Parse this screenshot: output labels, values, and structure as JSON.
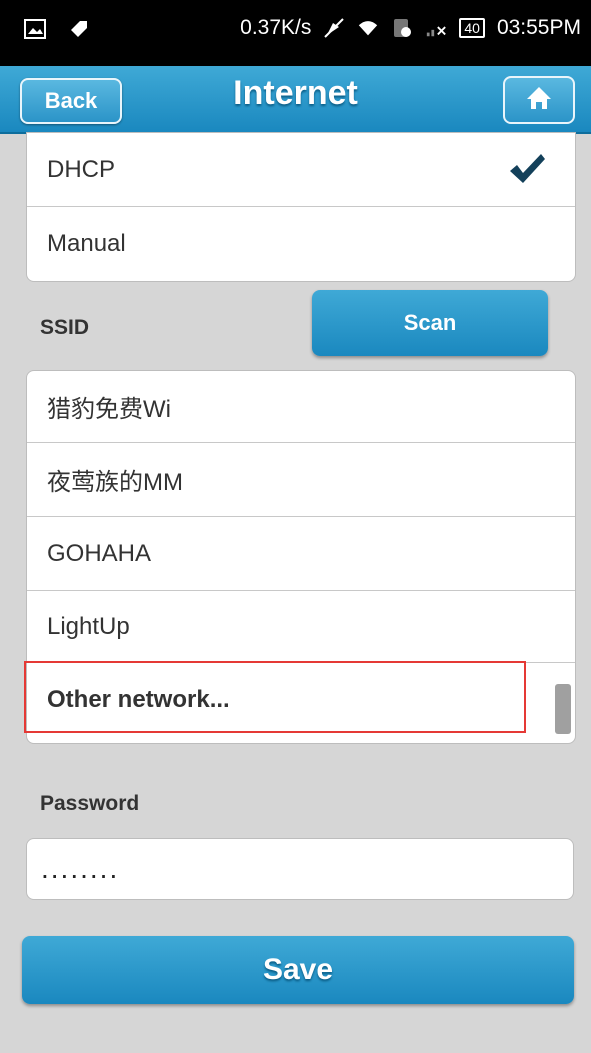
{
  "status_bar": {
    "speed": "0.37K/s",
    "battery": "40",
    "time": "03:55PM"
  },
  "header": {
    "title": "Internet",
    "back_label": "Back"
  },
  "ip_mode": {
    "options": [
      {
        "label": "DHCP",
        "selected": true
      },
      {
        "label": "Manual",
        "selected": false
      }
    ]
  },
  "ssid": {
    "label": "SSID",
    "scan_label": "Scan",
    "networks": [
      "猎豹免费Wi",
      "夜莺族的MM",
      "GOHAHA",
      "LightUp"
    ],
    "other_label": "Other network..."
  },
  "password": {
    "label": "Password",
    "value": "........"
  },
  "save_label": "Save"
}
